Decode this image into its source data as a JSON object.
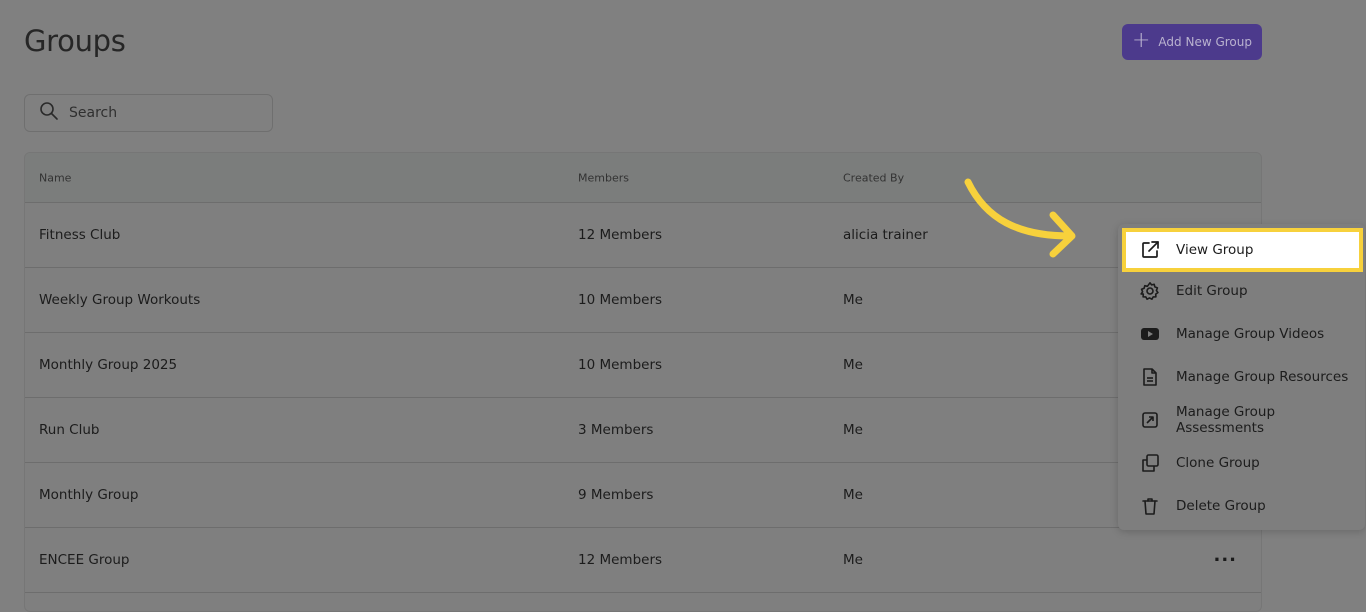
{
  "header": {
    "title": "Groups",
    "add_button_label": "Add New Group"
  },
  "search": {
    "placeholder": "Search"
  },
  "table": {
    "columns": {
      "name": "Name",
      "members": "Members",
      "created_by": "Created By"
    },
    "rows": [
      {
        "name": "Fitness Club",
        "members": "12 Members",
        "created_by": "alicia trainer"
      },
      {
        "name": "Weekly Group Workouts",
        "members": "10 Members",
        "created_by": "Me"
      },
      {
        "name": "Monthly Group 2025",
        "members": "10 Members",
        "created_by": "Me"
      },
      {
        "name": "Run Club",
        "members": "3 Members",
        "created_by": "Me"
      },
      {
        "name": "Monthly Group",
        "members": "9 Members",
        "created_by": "Me"
      },
      {
        "name": "ENCEE Group",
        "members": "12 Members",
        "created_by": "Me"
      }
    ],
    "row_actions_label": "···"
  },
  "context_menu": {
    "items": [
      {
        "label": "View Group",
        "icon": "external-link-icon"
      },
      {
        "label": "Edit Group",
        "icon": "gear-icon"
      },
      {
        "label": "Manage Group Videos",
        "icon": "video-play-icon"
      },
      {
        "label": "Manage Group Resources",
        "icon": "document-icon"
      },
      {
        "label": "Manage Group Assessments",
        "icon": "assessment-icon"
      },
      {
        "label": "Clone Group",
        "icon": "clone-icon"
      },
      {
        "label": "Delete Group",
        "icon": "trash-icon"
      }
    ],
    "highlighted_index": 0
  },
  "colors": {
    "accent_button": "#4c3a8c",
    "highlight_outline": "#f7d13c",
    "overlay_background": "#808080"
  }
}
